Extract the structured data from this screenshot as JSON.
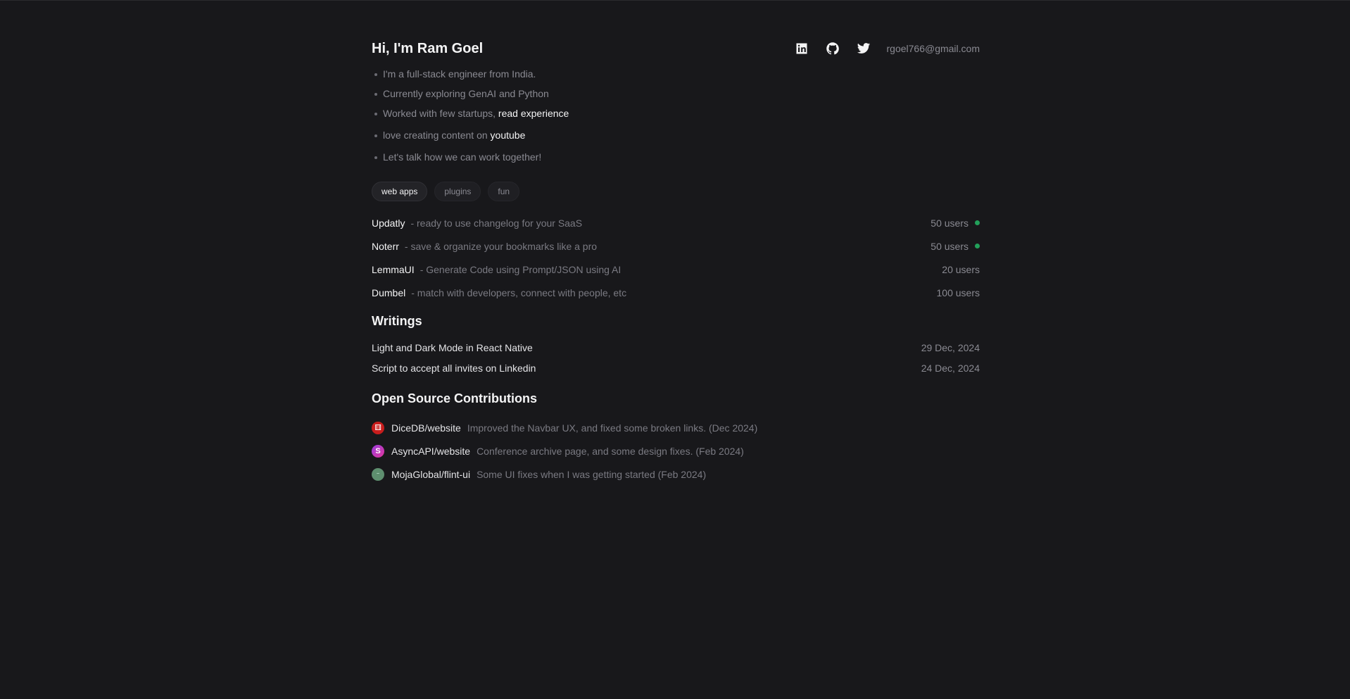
{
  "header": {
    "title": "Hi, I'm Ram Goel",
    "email": "rgoel766@gmail.com",
    "socials": [
      {
        "name": "linkedin-icon"
      },
      {
        "name": "github-icon"
      },
      {
        "name": "twitter-icon"
      }
    ]
  },
  "intro": {
    "line1": "I'm a full-stack engineer from India.",
    "line2": "Currently exploring GenAI and Python",
    "line3_prefix": "Worked with few startups,",
    "line3_link": "read experience",
    "line4_prefix": "love creating content on",
    "line4_link": "youtube",
    "line5": "Let's talk how we can work together!"
  },
  "filters": [
    {
      "label": "web apps",
      "active": true
    },
    {
      "label": "plugins",
      "active": false
    },
    {
      "label": "fun",
      "active": false
    }
  ],
  "projects": [
    {
      "name": "Updatly",
      "desc": "- ready to use changelog for your SaaS",
      "users": "50 users",
      "live": true
    },
    {
      "name": "Noterr",
      "desc": "- save & organize your bookmarks like a pro",
      "users": "50 users",
      "live": true
    },
    {
      "name": "LemmaUI",
      "desc": "- Generate Code using Prompt/JSON using AI",
      "users": "20 users",
      "live": false
    },
    {
      "name": "Dumbel",
      "desc": "- match with developers, connect with people, etc",
      "users": "100 users",
      "live": false
    }
  ],
  "writings": {
    "heading": "Writings",
    "items": [
      {
        "title": "Light and Dark Mode in React Native",
        "date": "29 Dec, 2024"
      },
      {
        "title": "Script to accept all invites on Linkedin",
        "date": "24 Dec, 2024"
      }
    ]
  },
  "contributions": {
    "heading": "Open Source Contributions",
    "items": [
      {
        "repo": "DiceDB/website",
        "desc": "Improved the Navbar UX, and fixed some broken links. (Dec 2024)",
        "icon": "dice-icon"
      },
      {
        "repo": "AsyncAPI/website",
        "desc": "Conference archive page, and some design fixes. (Feb 2024)",
        "icon": "asyncapi-icon"
      },
      {
        "repo": "MojaGlobal/flint-ui",
        "desc": "Some UI fixes when I was getting started (Feb 2024)",
        "icon": "mojaglobal-icon"
      }
    ]
  },
  "colors": {
    "background": "#18181b",
    "text": "#f4f4f5",
    "muted": "#8a8a92",
    "status_live": "#22a05a"
  }
}
